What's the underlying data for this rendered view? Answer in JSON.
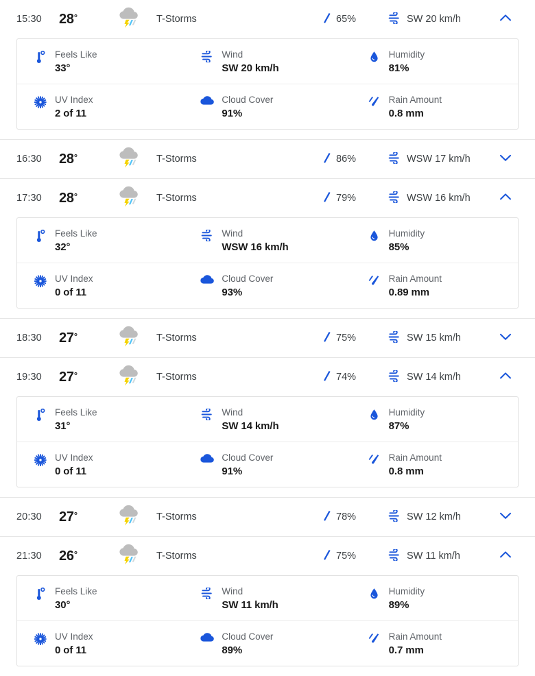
{
  "accent_color": "#1a56db",
  "brand_blue": "#1b5fdb",
  "text_color": "#3c4043",
  "label_color": "#5f6368",
  "cloud_gray": "#bdbdbd",
  "bolt_yellow": "#f5d300",
  "rain_cyan": "#4fc3f7",
  "detail_labels": {
    "feels_like": "Feels Like",
    "wind": "Wind",
    "humidity": "Humidity",
    "uv_index": "UV Index",
    "cloud_cover": "Cloud Cover",
    "rain_amount": "Rain Amount"
  },
  "icons": {
    "condition": "thunderstorm-icon",
    "precip": "raindrop-icon",
    "wind": "wind-icon",
    "expand": "chevron-down-icon",
    "collapse": "chevron-up-icon",
    "feels_like": "thermometer-icon",
    "humidity": "humidity-droplet-icon",
    "uv_index": "uv-sun-icon",
    "cloud_cover": "cloud-icon",
    "rain_amount": "rain-drops-icon"
  },
  "hours": [
    {
      "time": "15:30",
      "temp": "28",
      "degree": "°",
      "condition": "T-Storms",
      "precip": "65%",
      "wind": "SW 20 km/h",
      "expanded": true,
      "chevron": "⌃",
      "details": {
        "feels_like": "33°",
        "wind": "SW 20 km/h",
        "humidity": "81%",
        "uv_index": "2 of 11",
        "cloud_cover": "91%",
        "rain_amount": "0.8 mm"
      }
    },
    {
      "time": "16:30",
      "temp": "28",
      "degree": "°",
      "condition": "T-Storms",
      "precip": "86%",
      "wind": "WSW 17 km/h",
      "expanded": false,
      "chevron": "⌄",
      "details": null
    },
    {
      "time": "17:30",
      "temp": "28",
      "degree": "°",
      "condition": "T-Storms",
      "precip": "79%",
      "wind": "WSW 16 km/h",
      "expanded": true,
      "chevron": "⌃",
      "details": {
        "feels_like": "32°",
        "wind": "WSW 16 km/h",
        "humidity": "85%",
        "uv_index": "0 of 11",
        "cloud_cover": "93%",
        "rain_amount": "0.89 mm"
      }
    },
    {
      "time": "18:30",
      "temp": "27",
      "degree": "°",
      "condition": "T-Storms",
      "precip": "75%",
      "wind": "SW 15 km/h",
      "expanded": false,
      "chevron": "⌄",
      "details": null
    },
    {
      "time": "19:30",
      "temp": "27",
      "degree": "°",
      "condition": "T-Storms",
      "precip": "74%",
      "wind": "SW 14 km/h",
      "expanded": true,
      "chevron": "⌃",
      "details": {
        "feels_like": "31°",
        "wind": "SW 14 km/h",
        "humidity": "87%",
        "uv_index": "0 of 11",
        "cloud_cover": "91%",
        "rain_amount": "0.8 mm"
      }
    },
    {
      "time": "20:30",
      "temp": "27",
      "degree": "°",
      "condition": "T-Storms",
      "precip": "78%",
      "wind": "SW 12 km/h",
      "expanded": false,
      "chevron": "⌄",
      "details": null
    },
    {
      "time": "21:30",
      "temp": "26",
      "degree": "°",
      "condition": "T-Storms",
      "precip": "75%",
      "wind": "SW 11 km/h",
      "expanded": true,
      "chevron": "⌃",
      "details": {
        "feels_like": "30°",
        "wind": "SW 11 km/h",
        "humidity": "89%",
        "uv_index": "0 of 11",
        "cloud_cover": "89%",
        "rain_amount": "0.7 mm"
      }
    }
  ]
}
